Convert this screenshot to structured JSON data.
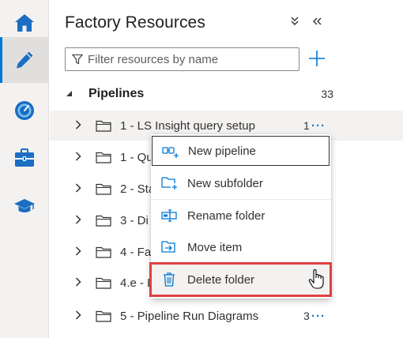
{
  "rail": {
    "items": [
      {
        "name": "home-icon",
        "active": false
      },
      {
        "name": "pencil-icon",
        "active": true
      },
      {
        "name": "monitor-gauge-icon",
        "active": false
      },
      {
        "name": "toolbox-icon",
        "active": false
      },
      {
        "name": "graduation-cap-icon",
        "active": false
      }
    ]
  },
  "panel": {
    "title": "Factory Resources",
    "collapse_icon": "chevron-double-down-icon",
    "hide_icon": "chevron-double-left-icon",
    "filter_placeholder": "Filter resources by name",
    "add_icon": "plus-icon"
  },
  "section": {
    "label": "Pipelines",
    "count": "33"
  },
  "rows": [
    {
      "name": "1 - LS Insight query setup",
      "count": "1",
      "more": "···",
      "hover": true
    },
    {
      "name": "1 - Qu",
      "count": "",
      "more": ""
    },
    {
      "name": "2 - Sta",
      "count": "",
      "more": ""
    },
    {
      "name": "3 - Di",
      "count": "",
      "more": ""
    },
    {
      "name": "4 - Fa",
      "count": "",
      "more": ""
    },
    {
      "name": "4.e - L",
      "count": "",
      "more": ""
    },
    {
      "name": "5 - Pipeline Run Diagrams",
      "count": "3",
      "more": "···"
    }
  ],
  "menu": {
    "items": [
      {
        "label": "New pipeline",
        "icon": "new-pipeline-icon"
      },
      {
        "label": "New subfolder",
        "icon": "new-subfolder-icon"
      },
      {
        "label": "Rename folder",
        "icon": "rename-icon"
      },
      {
        "label": "Move item",
        "icon": "move-item-icon"
      },
      {
        "label": "Delete folder",
        "icon": "trash-icon"
      }
    ]
  },
  "colors": {
    "accent": "#0078d4",
    "highlight_border": "#e04040",
    "rail_bg": "#f3f2f1"
  }
}
